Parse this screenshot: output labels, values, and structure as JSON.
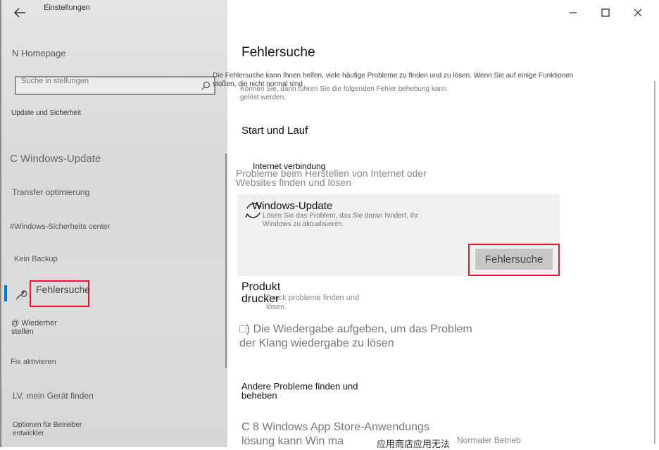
{
  "sidebar": {
    "window_title": "Einstellungen",
    "back_glyph": "←",
    "home": "N Homepage",
    "search_placeholder": "Suche in stellungen",
    "section_title": "Update und Sicherheit",
    "items": [
      {
        "label": "C Windows-Update"
      },
      {
        "label": "Transfer optimierung"
      },
      {
        "label": "#Windows-Sicherheits center"
      },
      {
        "label": "Kein Backup"
      },
      {
        "label": "Fehlersuche"
      },
      {
        "label": "@ Wiederher stellen"
      },
      {
        "label": "Fix aktivieren"
      },
      {
        "label": "LV, mein Gerät finden"
      },
      {
        "label": "Optionen für Betreiber entwickler"
      }
    ]
  },
  "window_controls": {
    "minimize": "—",
    "maximize": "☐",
    "close": "✕"
  },
  "main": {
    "title": "Fehlersuche",
    "desc1": "Die Fehlersuche kann Ihnen helfen, viele häufige Probleme zu finden und zu lösen. Wenn Sie auf einige Funktionen stoßen, die nicht normal sind",
    "desc2": "Können Sie, dann führen Sie die folgenden Fehler behebung kann gelöst werden.",
    "start_heading": "Start und Lauf",
    "internet": {
      "title": "Internet verbindung",
      "desc": "Probleme beim Herstellen von Internet oder Websites finden und lösen"
    },
    "windows_update": {
      "title": "Windows-Update",
      "desc": "Lösen Sie das Problem, das Sie daran hindert, Ihr Windows zu aktualisieren.",
      "button": "Fehlersuche"
    },
    "drucker": {
      "title": "Produkt drucker",
      "desc": "Druck probleme finden und lösen."
    },
    "playback": "□) Die Wiedergabe aufgeben, um das Problem der Klang wiedergabe zu lösen",
    "other_heading": "Andere Probleme finden und beheben",
    "store": "C 8 Windows App Store-Anwendungs lösung kann Win ma",
    "cn_text": "应用商店应用无法",
    "normal": "Normaler Betrieb"
  },
  "colors": {
    "accent": "#0078d7",
    "highlight": "#e01b24"
  }
}
